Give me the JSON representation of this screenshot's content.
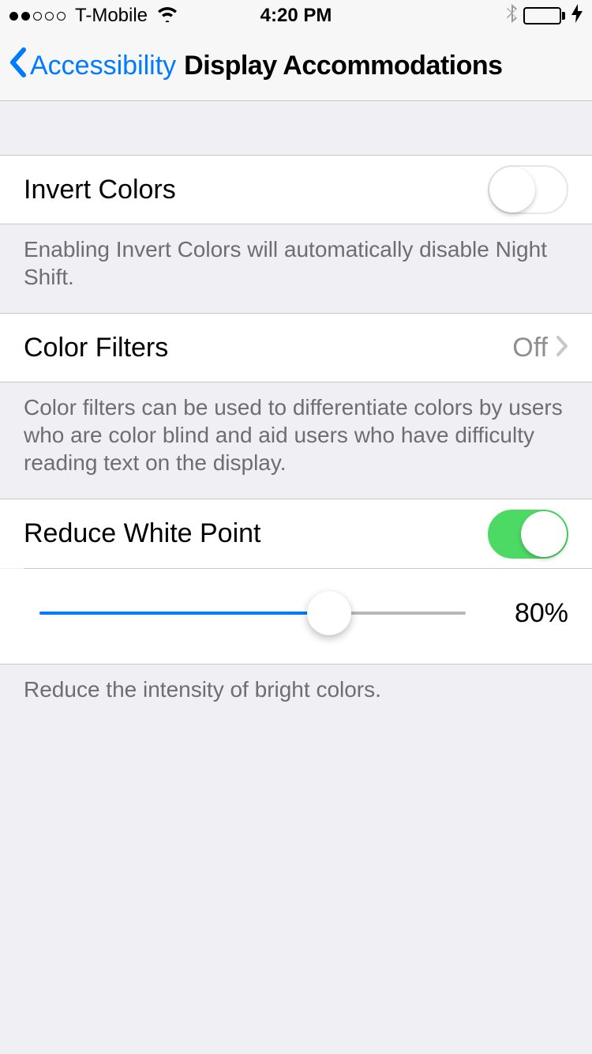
{
  "statusBar": {
    "carrier": "T-Mobile",
    "time": "4:20 PM"
  },
  "nav": {
    "back": "Accessibility",
    "title": "Display Accommodations"
  },
  "invertColors": {
    "label": "Invert Colors",
    "enabled": false,
    "footer": "Enabling Invert Colors will automatically disable Night Shift."
  },
  "colorFilters": {
    "label": "Color Filters",
    "value": "Off",
    "footer": "Color filters can be used to differentiate colors by users who are color blind and aid users who have difficulty reading text on the display."
  },
  "reduceWhitePoint": {
    "label": "Reduce White Point",
    "enabled": true,
    "sliderPercent": 68,
    "valueLabel": "80%",
    "footer": "Reduce the intensity of bright colors."
  }
}
